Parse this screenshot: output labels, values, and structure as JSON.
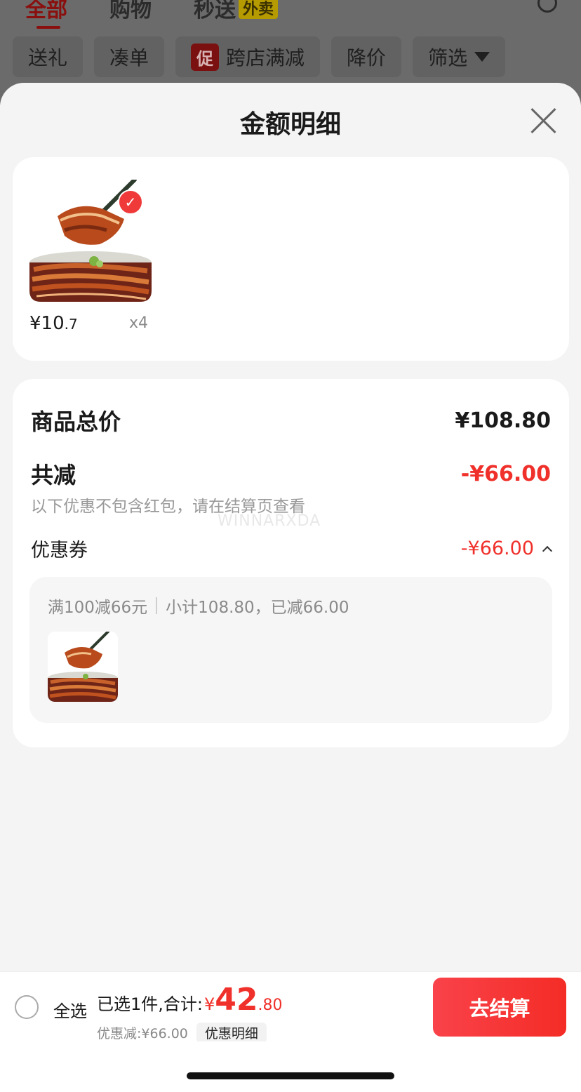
{
  "background_page": {
    "tabs": [
      {
        "label": "全部",
        "active": true
      },
      {
        "label": "购物"
      },
      {
        "label": "秒送",
        "badge": "外卖"
      }
    ],
    "chips": [
      {
        "label": "送礼"
      },
      {
        "label": "凑单"
      },
      {
        "label": "跨店满减",
        "promo": "促"
      },
      {
        "label": "降价"
      },
      {
        "label": "筛选"
      }
    ]
  },
  "sheet": {
    "title": "金额明细",
    "item": {
      "price_symbol": "¥",
      "price_int": "10",
      "price_dec": ".7",
      "quantity": "x4",
      "selected": true
    },
    "summary": {
      "total_label": "商品总价",
      "total_value": "¥108.80",
      "reduce_label": "共减",
      "reduce_value": "-¥66.00",
      "note": "以下优惠不包含红包，请在结算页查看",
      "watermark": "WINNARXDA",
      "coupon_label": "优惠券",
      "coupon_value": "-¥66.00",
      "coupon_rule": "满100减66元",
      "coupon_subtotal": "小计108.80，已减66.00"
    }
  },
  "bottom_bar": {
    "select_all": "全选",
    "selected_text": "已选1件,合计:",
    "currency": "¥",
    "total_int": "42",
    "total_dec": ".80",
    "discount_text": "优惠减:¥66.00",
    "detail_button": "优惠明细",
    "checkout_button": "去结算"
  },
  "colors": {
    "accent_red": "#f0302a",
    "checkout_gradient_start": "#f9424a",
    "checkout_gradient_end": "#f42c26"
  },
  "icons": [
    "search-icon",
    "funnel-icon",
    "close-icon",
    "check-icon",
    "chevron-up-icon",
    "radio-icon"
  ]
}
